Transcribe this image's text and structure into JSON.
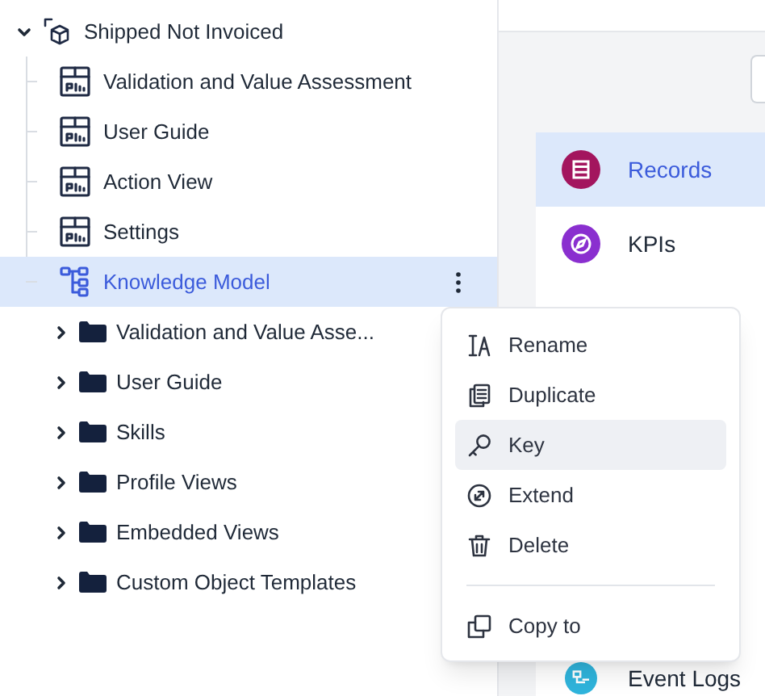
{
  "tree": {
    "label": "Shipped Not Invoiced",
    "expanded": true,
    "children": [
      {
        "label": "Validation and Value Assessment",
        "kind": "view",
        "selected": false
      },
      {
        "label": "User Guide",
        "kind": "view",
        "selected": false
      },
      {
        "label": "Action View",
        "kind": "view",
        "selected": false
      },
      {
        "label": "Settings",
        "kind": "view",
        "selected": false
      },
      {
        "label": "Knowledge Model",
        "kind": "model",
        "selected": true
      }
    ]
  },
  "folders": [
    {
      "label": "Validation and Value Asse...",
      "expanded": false
    },
    {
      "label": "User Guide",
      "expanded": false
    },
    {
      "label": "Skills",
      "expanded": false
    },
    {
      "label": "Profile Views",
      "expanded": false
    },
    {
      "label": "Embedded Views",
      "expanded": false
    },
    {
      "label": "Custom Object Templates",
      "expanded": false
    }
  ],
  "side_list": {
    "items": [
      {
        "label": "Records",
        "kind": "records",
        "selected": true,
        "color": "#a3155e"
      },
      {
        "label": "KPIs",
        "kind": "kpis",
        "selected": false,
        "color": "#8a2fcf"
      },
      {
        "label": "Event Logs",
        "kind": "events",
        "selected": false,
        "color": "#2fb4dc"
      }
    ]
  },
  "context_menu": {
    "items": [
      {
        "label": "Rename",
        "kind": "rename",
        "selected": false
      },
      {
        "label": "Duplicate",
        "kind": "duplicate",
        "selected": false
      },
      {
        "label": "Key",
        "kind": "key",
        "selected": true
      },
      {
        "label": "Extend",
        "kind": "extend",
        "selected": false
      },
      {
        "label": "Delete",
        "kind": "delete",
        "selected": false
      }
    ],
    "extra_items": [
      {
        "label": "Copy to",
        "kind": "copy",
        "selected": false
      }
    ]
  }
}
